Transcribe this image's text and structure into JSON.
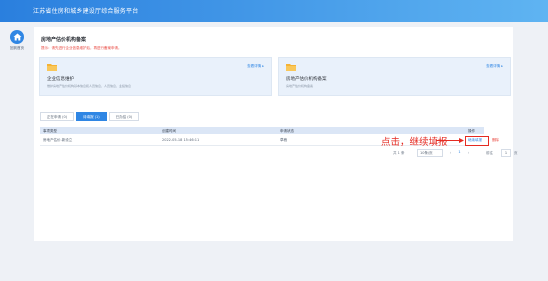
{
  "app": {
    "title": "江苏省住房和城乡建设厅综合服务平台"
  },
  "nav": {
    "home_label": "回到首页"
  },
  "page": {
    "title": "房地产估价机构备案",
    "tip": "提示：请先进行企业信息维护后，再进行备案申请。"
  },
  "cards": [
    {
      "title": "企业信息维护",
      "desc": "维护房地产估价机构基本信息和人员信息，人员信息，业绩信息",
      "more": "查看详情 ▸"
    },
    {
      "title": "房地产估价机构备案",
      "desc": "房地产估价机构备案",
      "more": "查看详情 ▸"
    }
  ],
  "tabs": [
    {
      "label": "正在申请 (0)",
      "active": false
    },
    {
      "label": "待填报 (1)",
      "active": true
    },
    {
      "label": "已办结 (0)",
      "active": false
    }
  ],
  "table": {
    "headers": [
      "事项类型",
      "创建时间",
      "申请状态",
      "操作"
    ],
    "rows": [
      {
        "type": "房地产估价-新设立",
        "time": "2022-05-18 15:46:11",
        "status": "草稿",
        "action": "继续填报",
        "delete": "删除"
      }
    ]
  },
  "annotation": "点击，继续填报",
  "pagination": {
    "total": "共 1 条",
    "page_size": "10条/页",
    "prev": "‹",
    "current": "1",
    "next": "›",
    "goto_label": "前往",
    "goto_value": "1",
    "page_suffix": "页"
  },
  "colors": {
    "primary": "#2f86e4",
    "danger": "#e52b22",
    "header_bg": "#dbe6f6",
    "card_bg": "#e9f1fb"
  }
}
